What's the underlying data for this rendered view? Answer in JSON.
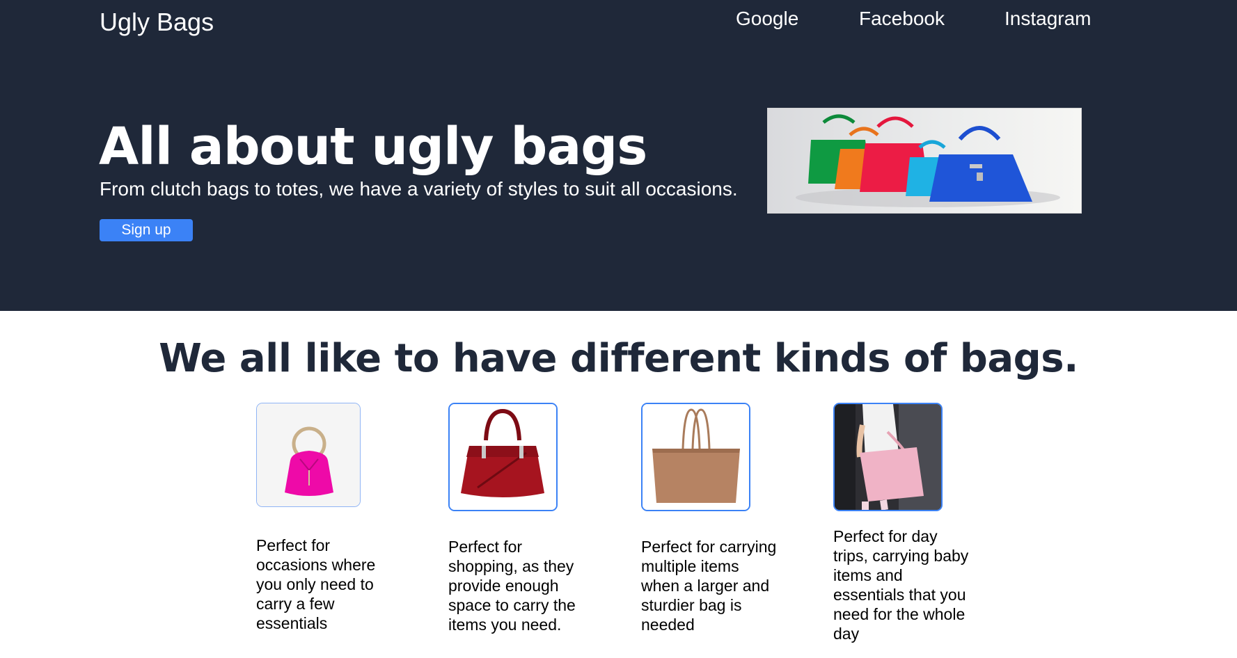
{
  "header": {
    "brand": "Ugly Bags",
    "nav": [
      {
        "label": "Google"
      },
      {
        "label": "Facebook"
      },
      {
        "label": "Instagram"
      }
    ]
  },
  "hero": {
    "title": "All about ugly bags",
    "subtitle": "From clutch bags to totes, we have a variety of styles to suit all occasions.",
    "signup_label": "Sign up",
    "image_alt": "row of colorful handbags"
  },
  "features": {
    "title": "We all like to have different kinds of bags.",
    "cards": [
      {
        "image": "pink-bucket-bag",
        "text": "Perfect for occasions where you only need to carry a few essentials"
      },
      {
        "image": "red-handbag",
        "text": "Perfect for shopping, as they provide enough space to carry the items you need."
      },
      {
        "image": "brown-tote-bag",
        "text": "Perfect for carrying multiple items when a larger and sturdier bag is needed"
      },
      {
        "image": "pink-shoulder-bag-photo",
        "text": "Perfect for day trips, carrying baby items and essentials that you need for the whole day"
      }
    ]
  },
  "colors": {
    "hero_background": "#1f2839",
    "accent": "#3b82f6",
    "heading_dark": "#1f2839"
  }
}
